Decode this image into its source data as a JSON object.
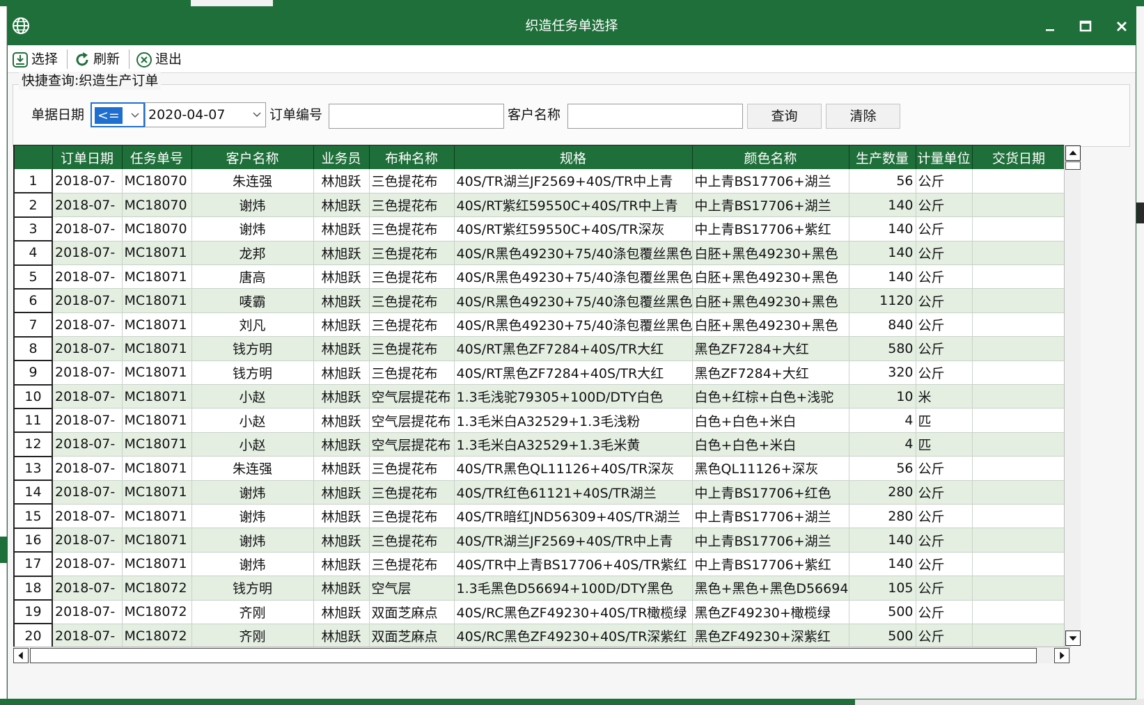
{
  "window": {
    "title": "织造任务单选择"
  },
  "toolbar": {
    "select_label": "选择",
    "refresh_label": "刷新",
    "exit_label": "退出"
  },
  "query": {
    "group_title": "快捷查询:织造生产订单",
    "date_label": "单据日期",
    "operator_value": "<=",
    "date_value": "2020-04-07",
    "order_no_label": "订单编号",
    "order_no_value": "",
    "customer_label": "客户名称",
    "customer_value": "",
    "search_label": "查询",
    "clear_label": "清除"
  },
  "grid": {
    "columns": [
      "订单日期",
      "任务单号",
      "客户名称",
      "业务员",
      "布种名称",
      "规格",
      "颜色名称",
      "生产数量",
      "计量单位",
      "交货日期"
    ],
    "rows": [
      [
        "1",
        "2018-07-",
        "MC18070",
        "朱连强",
        "林旭跃",
        "三色提花布",
        "40S/TR湖兰JF2569+40S/TR中上青",
        "中上青BS17706+湖兰",
        "56",
        "公斤",
        ""
      ],
      [
        "2",
        "2018-07-",
        "MC18070",
        "谢炜",
        "林旭跃",
        "三色提花布",
        "40S/RT紫红59550C+40S/TR中上青",
        "中上青BS17706+湖兰",
        "140",
        "公斤",
        ""
      ],
      [
        "3",
        "2018-07-",
        "MC18070",
        "谢炜",
        "林旭跃",
        "三色提花布",
        "40S/RT紫红59550C+40S/TR深灰",
        "中上青BS17706+紫红",
        "140",
        "公斤",
        ""
      ],
      [
        "4",
        "2018-07-",
        "MC18071",
        "龙邦",
        "林旭跃",
        "三色提花布",
        "40S/R黑色49230+75/40涤包覆丝黑色",
        "白胚+黑色49230+黑色",
        "140",
        "公斤",
        ""
      ],
      [
        "5",
        "2018-07-",
        "MC18071",
        "唐高",
        "林旭跃",
        "三色提花布",
        "40S/R黑色49230+75/40涤包覆丝黑色",
        "白胚+黑色49230+黑色",
        "140",
        "公斤",
        ""
      ],
      [
        "6",
        "2018-07-",
        "MC18071",
        "唛霸",
        "林旭跃",
        "三色提花布",
        "40S/R黑色49230+75/40涤包覆丝黑色",
        "白胚+黑色49230+黑色",
        "1120",
        "公斤",
        ""
      ],
      [
        "7",
        "2018-07-",
        "MC18071",
        "刘凡",
        "林旭跃",
        "三色提花布",
        "40S/R黑色49230+75/40涤包覆丝黑色",
        "白胚+黑色49230+黑色",
        "840",
        "公斤",
        ""
      ],
      [
        "8",
        "2018-07-",
        "MC18071",
        "钱方明",
        "林旭跃",
        "三色提花布",
        "40S/RT黑色ZF7284+40S/TR大红",
        "黑色ZF7284+大红",
        "580",
        "公斤",
        ""
      ],
      [
        "9",
        "2018-07-",
        "MC18071",
        "钱方明",
        "林旭跃",
        "三色提花布",
        "40S/RT黑色ZF7284+40S/TR大红",
        "黑色ZF7284+大红",
        "320",
        "公斤",
        ""
      ],
      [
        "10",
        "2018-07-",
        "MC18071",
        "小赵",
        "林旭跃",
        "空气层提花布",
        "1.3毛浅驼79305+100D/DTY白色",
        "白色+红棕+白色+浅驼",
        "10",
        "米",
        ""
      ],
      [
        "11",
        "2018-07-",
        "MC18071",
        "小赵",
        "林旭跃",
        "空气层提花布",
        "1.3毛米白A32529+1.3毛浅粉",
        "白色+白色+米白",
        "4",
        "匹",
        ""
      ],
      [
        "12",
        "2018-07-",
        "MC18071",
        "小赵",
        "林旭跃",
        "空气层提花布",
        "1.3毛米白A32529+1.3毛米黄",
        "白色+白色+米白",
        "4",
        "匹",
        ""
      ],
      [
        "13",
        "2018-07-",
        "MC18071",
        "朱连强",
        "林旭跃",
        "三色提花布",
        "40S/TR黑色QL11126+40S/TR深灰",
        "黑色QL11126+深灰",
        "56",
        "公斤",
        ""
      ],
      [
        "14",
        "2018-07-",
        "MC18071",
        "谢炜",
        "林旭跃",
        "三色提花布",
        "40S/TR红色61121+40S/TR湖兰",
        "中上青BS17706+红色",
        "280",
        "公斤",
        ""
      ],
      [
        "15",
        "2018-07-",
        "MC18071",
        "谢炜",
        "林旭跃",
        "三色提花布",
        "40S/TR暗红JND56309+40S/TR湖兰",
        "中上青BS17706+湖兰",
        "280",
        "公斤",
        ""
      ],
      [
        "16",
        "2018-07-",
        "MC18071",
        "谢炜",
        "林旭跃",
        "三色提花布",
        "40S/TR湖兰JF2569+40S/TR中上青",
        "中上青BS17706+湖兰",
        "140",
        "公斤",
        ""
      ],
      [
        "17",
        "2018-07-",
        "MC18071",
        "谢炜",
        "林旭跃",
        "三色提花布",
        "40S/TR中上青BS17706+40S/TR紫红",
        "中上青BS17706+紫红",
        "140",
        "公斤",
        ""
      ],
      [
        "18",
        "2018-07-",
        "MC18072",
        "钱方明",
        "林旭跃",
        "空气层",
        "1.3毛黑色D56694+100D/DTY黑色",
        "黑色+黑色+黑色D56694",
        "105",
        "公斤",
        ""
      ],
      [
        "19",
        "2018-07-",
        "MC18072",
        "齐刚",
        "林旭跃",
        "双面芝麻点",
        "40S/RC黑色ZF49230+40S/TR橄榄绿",
        "黑色ZF49230+橄榄绿",
        "500",
        "公斤",
        ""
      ],
      [
        "20",
        "2018-07-",
        "MC18072",
        "齐刚",
        "林旭跃",
        "双面芝麻点",
        "40S/RC黑色ZF49230+40S/TR深紫红",
        "黑色ZF49230+深紫红",
        "500",
        "公斤",
        ""
      ]
    ]
  },
  "colors": {
    "accent": "#1f6f3a",
    "row_alt": "#e4efe2",
    "selection": "#1e6fd0"
  },
  "icons": [
    "globe-icon",
    "minimize-icon",
    "maximize-icon",
    "close-icon",
    "select-download-icon",
    "refresh-icon",
    "exit-icon"
  ]
}
